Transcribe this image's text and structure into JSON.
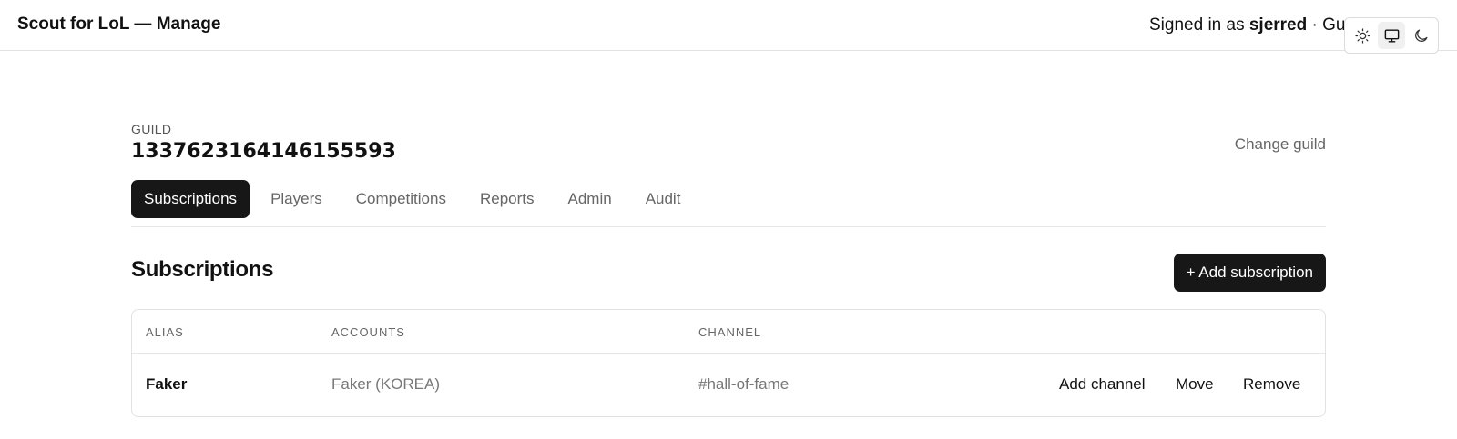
{
  "header": {
    "app_title": "Scout for LoL — Manage",
    "signed_in_prefix": "Signed in as ",
    "username": "sjerred",
    "signed_in_suffix": " · Gui"
  },
  "theme_switch": {
    "options": [
      {
        "icon": "sun-icon",
        "active": false
      },
      {
        "icon": "monitor-icon",
        "active": true
      },
      {
        "icon": "moon-icon",
        "active": false
      }
    ]
  },
  "guild": {
    "label": "GUILD",
    "id": "1337623164146155593",
    "change_label": "Change guild"
  },
  "tabs": [
    {
      "label": "Subscriptions",
      "active": true
    },
    {
      "label": "Players",
      "active": false
    },
    {
      "label": "Competitions",
      "active": false
    },
    {
      "label": "Reports",
      "active": false
    },
    {
      "label": "Admin",
      "active": false
    },
    {
      "label": "Audit",
      "active": false
    }
  ],
  "section": {
    "title": "Subscriptions",
    "add_button": "+ Add subscription"
  },
  "table": {
    "columns": [
      "ALIAS",
      "ACCOUNTS",
      "CHANNEL"
    ],
    "rows": [
      {
        "alias": "Faker",
        "accounts": "Faker (KOREA)",
        "channel": "#hall-of-fame",
        "actions": [
          "Add channel",
          "Move",
          "Remove"
        ]
      }
    ]
  },
  "colors": {
    "primary_dark": "#171717",
    "muted_text": "#666666",
    "border": "#e2e2e2"
  }
}
